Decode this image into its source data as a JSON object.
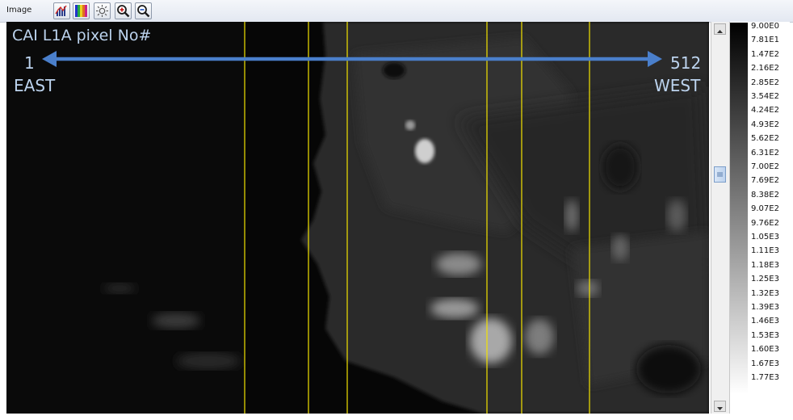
{
  "toolbar": {
    "menu_image": "Image",
    "buttons": [
      "histogram-icon",
      "colormap-icon",
      "brightness-icon",
      "zoom-in-icon",
      "zoom-out-icon"
    ]
  },
  "overlay": {
    "title": "CAI L1A pixel No#",
    "east_number": "1",
    "east_label": "EAST",
    "west_number": "512",
    "west_label": "WEST",
    "arrow_color": "#4a7fcb",
    "marker_line_color": "#f3e300"
  },
  "legend": {
    "labels": [
      "9.00E0",
      "7.81E1",
      "1.47E2",
      "2.16E2",
      "2.85E2",
      "3.54E2",
      "4.24E2",
      "4.93E2",
      "5.62E2",
      "6.31E2",
      "7.00E2",
      "7.69E2",
      "8.38E2",
      "9.07E2",
      "9.76E2",
      "1.05E3",
      "1.11E3",
      "1.18E3",
      "1.25E3",
      "1.32E3",
      "1.39E3",
      "1.46E3",
      "1.53E3",
      "1.60E3",
      "1.67E3",
      "1.77E3"
    ]
  }
}
